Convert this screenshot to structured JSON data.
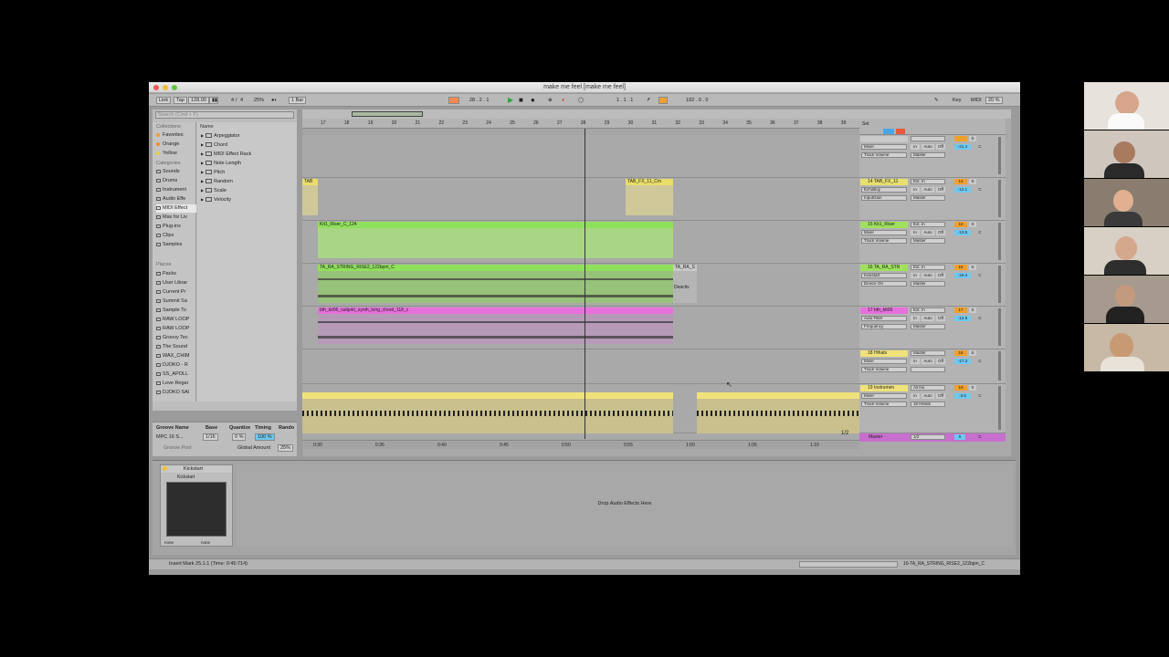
{
  "window": {
    "title": "make me feel  [make me feel]"
  },
  "controlbar": {
    "link": "Link",
    "tap": "Tap",
    "tempo": "128.00",
    "signature_num": "4",
    "signature_den": "4",
    "groove": "25%",
    "quantize": "1 Bar",
    "position": "28 . 2 . 1",
    "loop_start": "1 . 1 . 1",
    "loop_length": "192 . 0 . 0",
    "key": "Key",
    "midi": "MIDI",
    "cpu": "20 %"
  },
  "browser": {
    "search_placeholder": "Search (Cmd + F)",
    "collections_label": "Collections",
    "collections": [
      {
        "label": "Favorites",
        "color": "#e9a23b"
      },
      {
        "label": "Orange",
        "color": "#f28a2e"
      },
      {
        "label": "Yellow",
        "color": "#e8d23a"
      }
    ],
    "categories_label": "Categories",
    "categories": [
      "Sounds",
      "Drums",
      "Instrument",
      "Audio Effe",
      "MIDI Effect",
      "Max for Liv",
      "Plug-ins",
      "Clips",
      "Samples"
    ],
    "places_label": "Places",
    "places": [
      "Packs",
      "User Librar",
      "Current Pr",
      "Summit Sa",
      "Sample To",
      "RAW LOOP",
      "RAW LOOP",
      "Groovy Tec",
      "The Sound",
      "WAX_CHIM",
      "DJOKO - R",
      "SS_APOLL",
      "Love Regar",
      "DJOKO SAI"
    ],
    "name_header": "Name",
    "items": [
      "Arpeggiator",
      "Chord",
      "MIDI Effect Rack",
      "Note Length",
      "Pitch",
      "Random",
      "Scale",
      "Velocity"
    ]
  },
  "groove": {
    "headers": [
      "Groove Name",
      "Base",
      "Quantize",
      "Timing",
      "Rando"
    ],
    "row": {
      "name": "MPC 16 S...",
      "base": "1/16",
      "quantize": "0 %",
      "timing": "100 %"
    },
    "pool_label": "Groove Pool",
    "global_label": "Global Amount",
    "global_value": "25%"
  },
  "ruler": {
    "bars": [
      "17",
      "18",
      "19",
      "20",
      "21",
      "22",
      "23",
      "24",
      "25",
      "26",
      "27",
      "28",
      "29",
      "30",
      "31",
      "32",
      "33",
      "34",
      "35",
      "36",
      "37",
      "38",
      "39"
    ]
  },
  "timeline": {
    "times": [
      "0:30",
      "0:35",
      "0:40",
      "0:45",
      "0:50",
      "0:55",
      "1:00",
      "1:05",
      "1:10"
    ],
    "page": "1/2"
  },
  "clips": {
    "fx_a": "TAB",
    "fx_b": "TAB_FX_11_Cm",
    "riser": "Kit1_Riser_C_124",
    "string": "TA_RA_STRING_RISE2_122bpm_C",
    "string_short": "TA_RA_S",
    "deactivated": "Deactiv",
    "synth": "bth_kit06_subjekt_synth_long_chord_118_c"
  },
  "tracks": [
    {
      "name": "",
      "device": "Mixer",
      "param": "Track Volume",
      "input": "",
      "output": "Master",
      "number": "",
      "volume": "-21.4",
      "pan": "C",
      "color": "#c9c9c9"
    },
    {
      "name": "14 TAB_FX_11",
      "device": "EchoBoy",
      "param": "InputGain",
      "input": "Ext. In",
      "output": "Master",
      "number": "14",
      "volume": "-12.1",
      "pan": "C",
      "color": "#e8df6e"
    },
    {
      "name": "15 Kit1_Riser",
      "device": "Mixer",
      "param": "Track Volume",
      "input": "Ext. In",
      "output": "Master",
      "number": "15",
      "volume": "-13.5",
      "pan": "C",
      "color": "#9fe15d"
    },
    {
      "name": "16 TA_RA_STR",
      "device": "Kickstart",
      "param": "Device On",
      "input": "Ext. In",
      "output": "Master",
      "number": "16",
      "volume": "-19.4",
      "pan": "C",
      "color": "#9fe15d"
    },
    {
      "name": "17 bth_kit06",
      "device": "Auto Filter",
      "param": "Frequency",
      "input": "Ext. In",
      "output": "Master",
      "number": "17",
      "volume": "-12.8",
      "pan": "C",
      "color": "#e76fde"
    },
    {
      "name": "18 Hihats",
      "device": "Mixer",
      "param": "Track Volume",
      "input": "Master",
      "output": "",
      "number": "18",
      "volume": "-17.3",
      "pan": "C",
      "color": "#f0e27a"
    },
    {
      "name": "19 Instrumen",
      "device": "Mixer",
      "param": "Track Volume",
      "input": "All Ins",
      "output": "18 Hihats",
      "number": "19",
      "volume": "-3.5",
      "pan": "C",
      "color": "#f0e27a"
    }
  ],
  "master": {
    "name": "Master",
    "value": "1/2",
    "number": "0",
    "pan": "C"
  },
  "mixer_buttons": {
    "in": "In",
    "auto": "Auto",
    "off": "Off",
    "solo": "S",
    "all_channels": "All Channe"
  },
  "device_view": {
    "device_name": "Kickstart",
    "preset_name": "Kickstart",
    "sidechain_a": "none",
    "sidechain_b": "none",
    "drop_hint": "Drop Audio Effects Here"
  },
  "status": {
    "message": "Insert Mark 25.1.1 (Time: 0:45:714)",
    "clip": "16-TA_RA_STRING_RISE2_122bpm_C"
  }
}
